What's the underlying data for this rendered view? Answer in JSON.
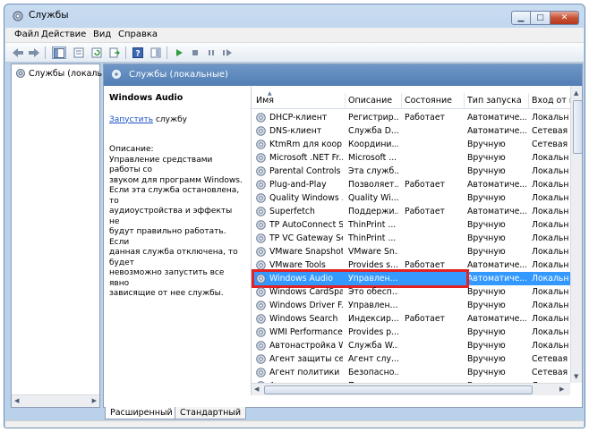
{
  "window": {
    "title": "Службы"
  },
  "menu": [
    {
      "label": "Файл"
    },
    {
      "label": "Действие"
    },
    {
      "label": "Вид"
    },
    {
      "label": "Справка"
    }
  ],
  "toolbar": {
    "icons": [
      "back-icon",
      "forward-icon",
      "console-tree-icon",
      "properties-icon",
      "refresh-icon",
      "export-icon",
      "help-icon",
      "show-hide-icon",
      "start-icon",
      "stop-icon",
      "pause-icon",
      "restart-icon"
    ]
  },
  "tree": {
    "item_label": "Службы (локальны"
  },
  "main": {
    "header_title": "Службы (локальные)",
    "selected_service": "Windows Audio",
    "start_link": "Запустить",
    "start_suffix": " службу",
    "description_label": "Описание:",
    "description_lines": [
      "Управление средствами работы со",
      "звуком для программ Windows.",
      "Если эта служба остановлена, то",
      "аудиоустройства и эффекты не",
      "будут правильно работать.  Если",
      "данная служба отключена, то будет",
      "невозможно запустить все явно",
      "зависящие от нее службы."
    ]
  },
  "columns": {
    "name": "Имя",
    "description": "Описание",
    "state": "Состояние",
    "startup": "Тип запуска",
    "logon": "Вход от и"
  },
  "services": [
    {
      "name": "DHCP-клиент",
      "description": "Регистрир...",
      "state": "Работает",
      "startup": "Автоматиче...",
      "logon": "Локальн"
    },
    {
      "name": "DNS-клиент",
      "description": "Служба D...",
      "state": "",
      "startup": "Автоматиче...",
      "logon": "Сетевая с"
    },
    {
      "name": "KtmRm для коор...",
      "description": "Координи...",
      "state": "",
      "startup": "Вручную",
      "logon": "Сетевая с"
    },
    {
      "name": "Microsoft .NET Fr...",
      "description": "Microsoft ...",
      "state": "",
      "startup": "Вручную",
      "logon": "Локальн"
    },
    {
      "name": "Parental Controls",
      "description": "Эта служб...",
      "state": "",
      "startup": "Вручную",
      "logon": "Локальн"
    },
    {
      "name": "Plug-and-Play",
      "description": "Позволяет...",
      "state": "Работает",
      "startup": "Автоматиче...",
      "logon": "Локальн"
    },
    {
      "name": "Quality Windows ...",
      "description": "Quality Wi...",
      "state": "",
      "startup": "Вручную",
      "logon": "Локальн"
    },
    {
      "name": "Superfetch",
      "description": "Поддержи...",
      "state": "Работает",
      "startup": "Автоматиче...",
      "logon": "Локальн"
    },
    {
      "name": "TP AutoConnect S...",
      "description": "ThinPrint ...",
      "state": "",
      "startup": "Вручную",
      "logon": "Локальн"
    },
    {
      "name": "TP VC Gateway Se...",
      "description": "ThinPrint ...",
      "state": "",
      "startup": "Вручную",
      "logon": "Локальн"
    },
    {
      "name": "VMware Snapshot...",
      "description": "VMware Sn...",
      "state": "",
      "startup": "Вручную",
      "logon": "Локальн"
    },
    {
      "name": "VMware Tools",
      "description": "Provides s...",
      "state": "Работает",
      "startup": "Автоматиче...",
      "logon": "Локальн"
    },
    {
      "name": "Windows Audio",
      "description": "Управлен...",
      "state": "",
      "startup": "Автоматиче...",
      "logon": "Локальн"
    },
    {
      "name": "Windows CardSpa...",
      "description": "Это обесп...",
      "state": "",
      "startup": "Вручную",
      "logon": "Локальн"
    },
    {
      "name": "Windows Driver F...",
      "description": "Управлен...",
      "state": "",
      "startup": "Вручную",
      "logon": "Локальн"
    },
    {
      "name": "Windows Search",
      "description": "Индексир...",
      "state": "Работает",
      "startup": "Автоматиче...",
      "logon": "Локальн"
    },
    {
      "name": "WMI Performance...",
      "description": "Provides p...",
      "state": "",
      "startup": "Вручную",
      "logon": "Локальн"
    },
    {
      "name": "Автонастройка W...",
      "description": "Служба W...",
      "state": "",
      "startup": "Вручную",
      "logon": "Локальн"
    },
    {
      "name": "Агент защиты сет...",
      "description": "Агент слу...",
      "state": "",
      "startup": "Вручную",
      "logon": "Сетевая с"
    },
    {
      "name": "Агент политики I...",
      "description": "Безопасно...",
      "state": "",
      "startup": "Вручную",
      "logon": "Сетевая с"
    },
    {
      "name": "Адаптер произво...",
      "description": "Предоста...",
      "state": "",
      "startup": "Вручную",
      "logon": "Локальн"
    }
  ],
  "selected_index": 12,
  "tabs": [
    {
      "label": "Расширенный"
    },
    {
      "label": "Стандартный"
    }
  ],
  "colors": {
    "selection": "#3399ff",
    "highlight_box": "#e32323",
    "header_blue": "#527fb5"
  }
}
